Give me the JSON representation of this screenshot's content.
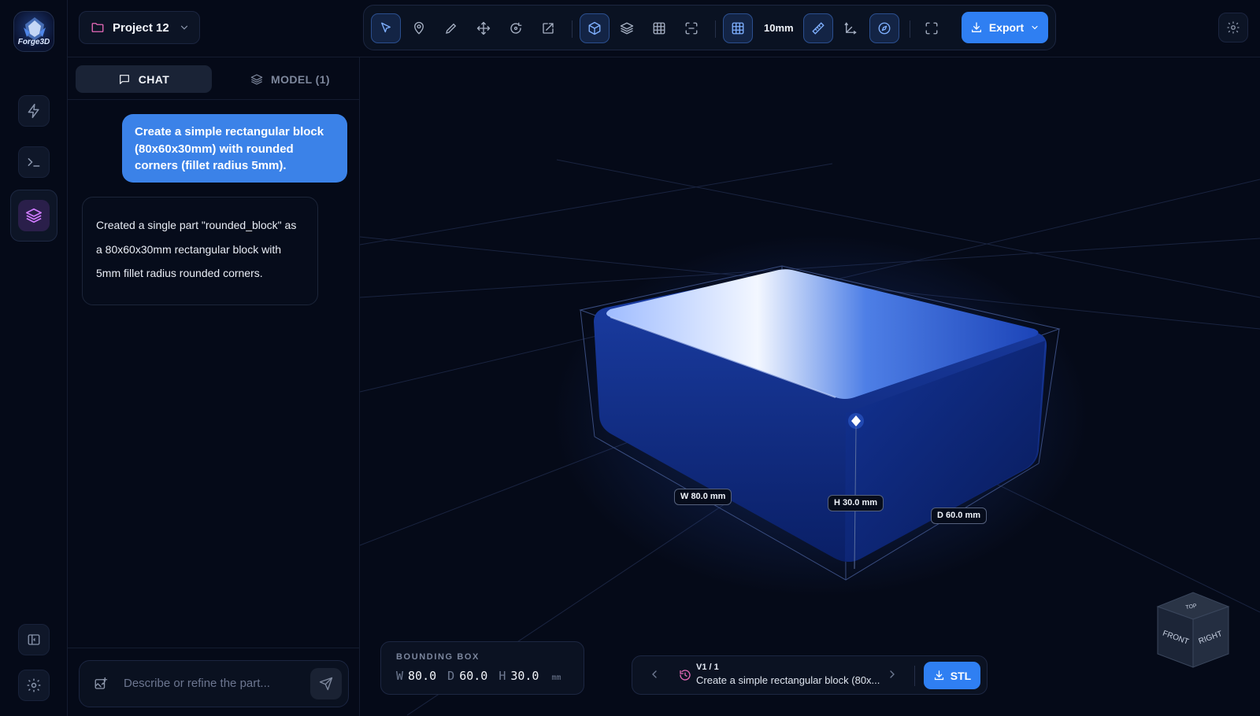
{
  "app": {
    "logo_text": "Forge3D"
  },
  "project": {
    "name": "Project 12"
  },
  "toolbar": {
    "grid_size": "10mm",
    "export_label": "Export",
    "tools": [
      "select-tool",
      "pin-tool",
      "draw-tool",
      "move-tool",
      "rotate-tool",
      "scale-tool",
      "cube-view",
      "layers",
      "table",
      "focus",
      "grid-toggle",
      "measure",
      "axes",
      "navigate",
      "fullscreen"
    ]
  },
  "sidebar": {
    "items": [
      {
        "icon": "lightning-icon"
      },
      {
        "icon": "terminal-icon"
      },
      {
        "icon": "layers-icon",
        "active": true
      }
    ]
  },
  "panel": {
    "tabs": [
      {
        "label": "CHAT",
        "active": true
      },
      {
        "label": "MODEL (1)",
        "active": false
      }
    ],
    "messages": [
      {
        "role": "user",
        "text": "Create a simple rectangular block (80x60x30mm) with rounded corners (fillet radius 5mm)."
      },
      {
        "role": "assistant",
        "text": "Created a single part \"rounded_block\" as a 80x60x30mm rectangular block with 5mm fillet radius rounded corners."
      }
    ],
    "composer": {
      "placeholder": "Describe or refine the part..."
    }
  },
  "viewport": {
    "dimensions": {
      "w": "W 80.0 mm",
      "h": "H 30.0 mm",
      "d": "D 60.0 mm"
    },
    "view_cube": {
      "top": "TOP",
      "front": "FRONT",
      "right": "RIGHT"
    }
  },
  "bounding_box": {
    "title": "BOUNDING BOX",
    "w_key": "W",
    "w": "80.0",
    "d_key": "D",
    "d": "60.0",
    "h_key": "H",
    "h": "30.0",
    "unit": "mm"
  },
  "history": {
    "version": "V1 / 1",
    "description": "Create a simple rectangular block (80x...",
    "stl_label": "STL"
  },
  "colors": {
    "accent": "#2f7ff2",
    "pink": "#e569b8",
    "background": "#050a18"
  }
}
